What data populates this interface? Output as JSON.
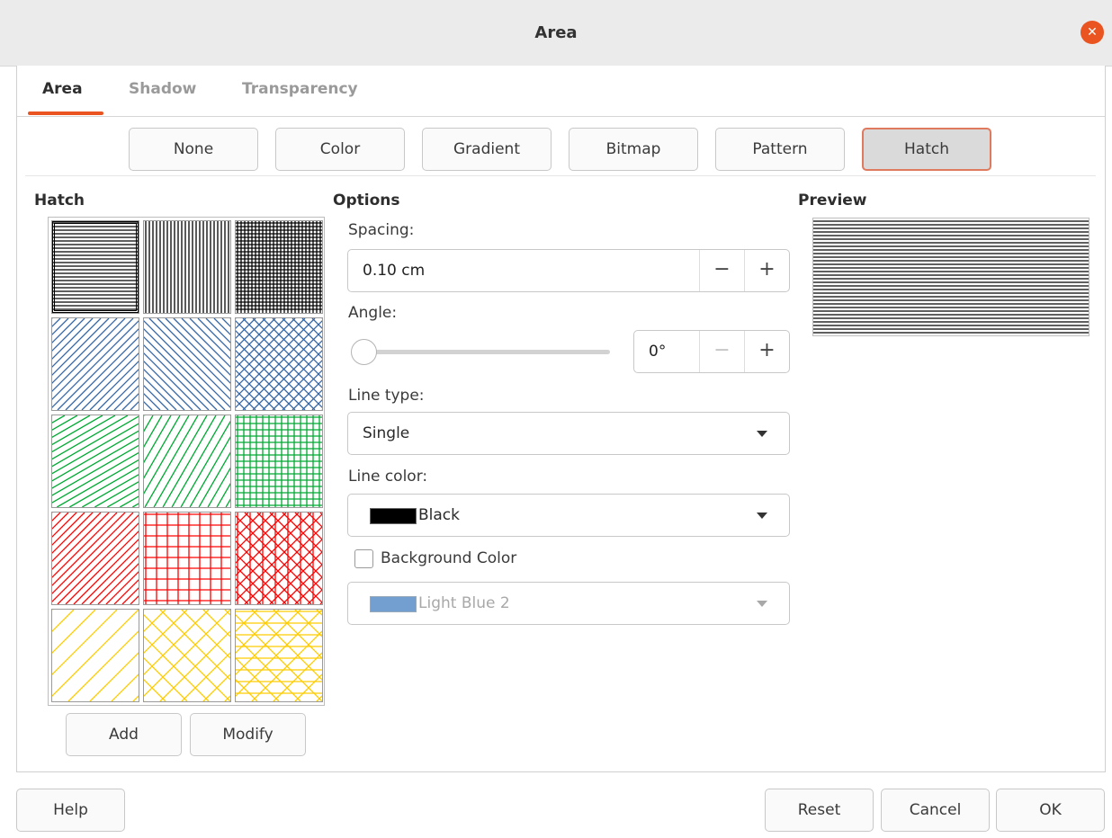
{
  "window": {
    "title": "Area"
  },
  "tabs": [
    {
      "label": "Area",
      "active": true
    },
    {
      "label": "Shadow",
      "active": false
    },
    {
      "label": "Transparency",
      "active": false
    }
  ],
  "fill_types": [
    "None",
    "Color",
    "Gradient",
    "Bitmap",
    "Pattern",
    "Hatch"
  ],
  "selected_fill_type": "Hatch",
  "hatch": {
    "heading": "Hatch",
    "swatches": [
      {
        "color": "#000000",
        "pattern": "horizontal",
        "selected": true
      },
      {
        "color": "#000000",
        "pattern": "vertical",
        "selected": false
      },
      {
        "color": "#000000",
        "pattern": "grid",
        "selected": false
      },
      {
        "color": "#3465a4",
        "pattern": "diagonal-45",
        "selected": false
      },
      {
        "color": "#3465a4",
        "pattern": "diagonal-135",
        "selected": false
      },
      {
        "color": "#3465a4",
        "pattern": "crosshatch",
        "selected": false
      },
      {
        "color": "#00a933",
        "pattern": "diagonal-30",
        "selected": false
      },
      {
        "color": "#00a933",
        "pattern": "diagonal-60",
        "selected": false
      },
      {
        "color": "#00a933",
        "pattern": "grid-dense",
        "selected": false
      },
      {
        "color": "#ff0000",
        "pattern": "diagonal-45",
        "selected": false
      },
      {
        "color": "#ff0000",
        "pattern": "grid",
        "selected": false
      },
      {
        "color": "#ff0000",
        "pattern": "triple",
        "selected": false
      },
      {
        "color": "#ffcc00",
        "pattern": "diagonal-45-wide",
        "selected": false
      },
      {
        "color": "#ffcc00",
        "pattern": "crosshatch-wide",
        "selected": false
      },
      {
        "color": "#ffcc00",
        "pattern": "triple-wide",
        "selected": false
      }
    ],
    "add_label": "Add",
    "modify_label": "Modify"
  },
  "options": {
    "heading": "Options",
    "spacing_label": "Spacing:",
    "spacing_value": "0.10 cm",
    "angle_label": "Angle:",
    "angle_value": "0°",
    "angle_slider_fraction": 0,
    "line_type_label": "Line type:",
    "line_type_value": "Single",
    "line_color_label": "Line color:",
    "line_color_value": "Black",
    "line_color_hex": "#000000",
    "background_color_label": "Background Color",
    "background_color_checked": false,
    "background_color_value": "Light Blue 2",
    "background_color_hex": "#729fcf",
    "minus_glyph": "−",
    "plus_glyph": "+"
  },
  "preview": {
    "heading": "Preview"
  },
  "footer": {
    "help_label": "Help",
    "reset_label": "Reset",
    "cancel_label": "Cancel",
    "ok_label": "OK"
  },
  "icons": {
    "close": "close-icon",
    "dropdown": "chevron-down-icon"
  },
  "accent_color": "#e95420"
}
